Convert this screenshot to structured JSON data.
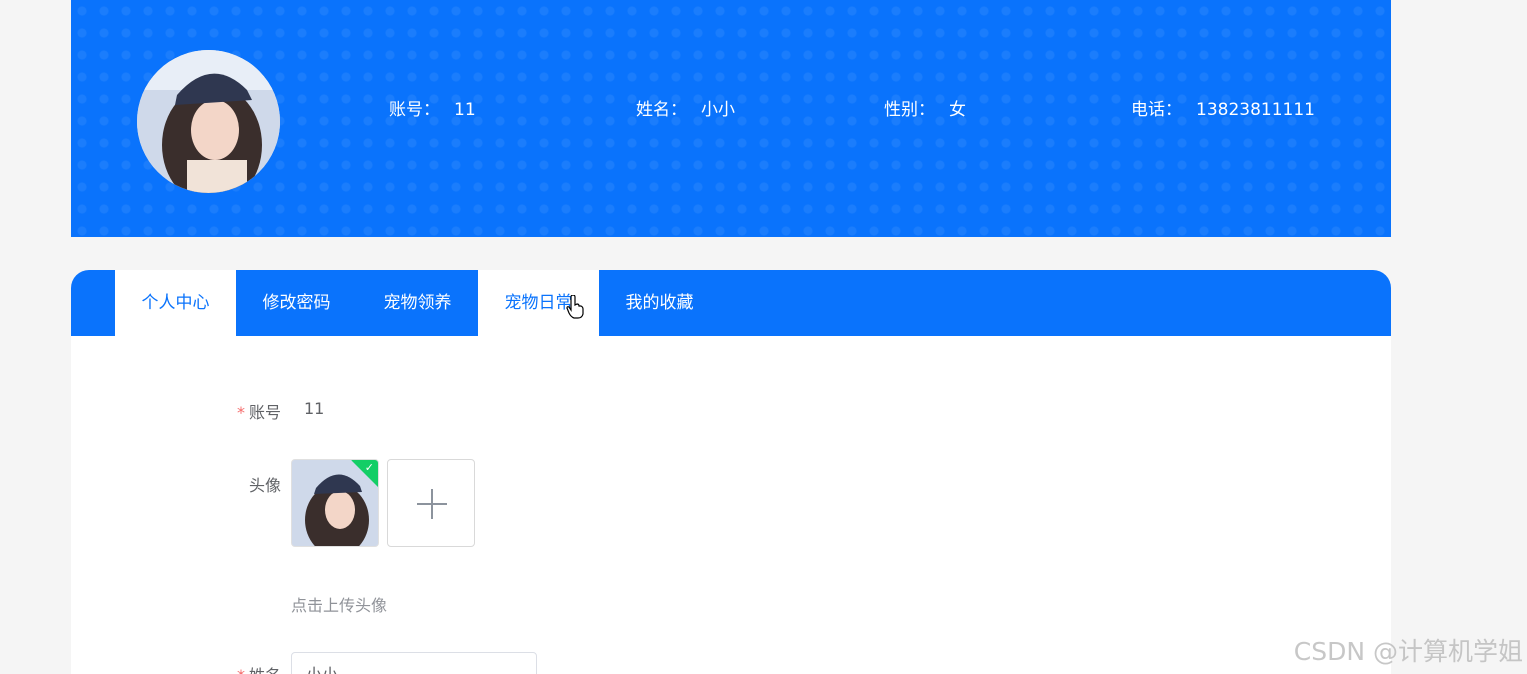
{
  "header": {
    "avatar_icon": "user-photo",
    "account_label": "账号：",
    "account_value": "11",
    "name_label": "姓名：",
    "name_value": "小小",
    "gender_label": "性别：",
    "gender_value": "女",
    "phone_label": "电话：",
    "phone_value": "13823811111"
  },
  "tabs": [
    {
      "label": "个人中心",
      "active": true
    },
    {
      "label": "修改密码",
      "active": false
    },
    {
      "label": "宠物领养",
      "active": false
    },
    {
      "label": "宠物日常",
      "active": true
    },
    {
      "label": "我的收藏",
      "active": false
    }
  ],
  "form": {
    "required_mark": "*",
    "account_label": "账号",
    "account_value": "11",
    "avatar_label": "头像",
    "upload_hint": "点击上传头像",
    "name_label": "姓名",
    "name_value": "小小"
  },
  "watermark": "CSDN @计算机学姐",
  "colors": {
    "primary": "#0a73fc",
    "success": "#13ce66",
    "required": "#f56c6c"
  }
}
